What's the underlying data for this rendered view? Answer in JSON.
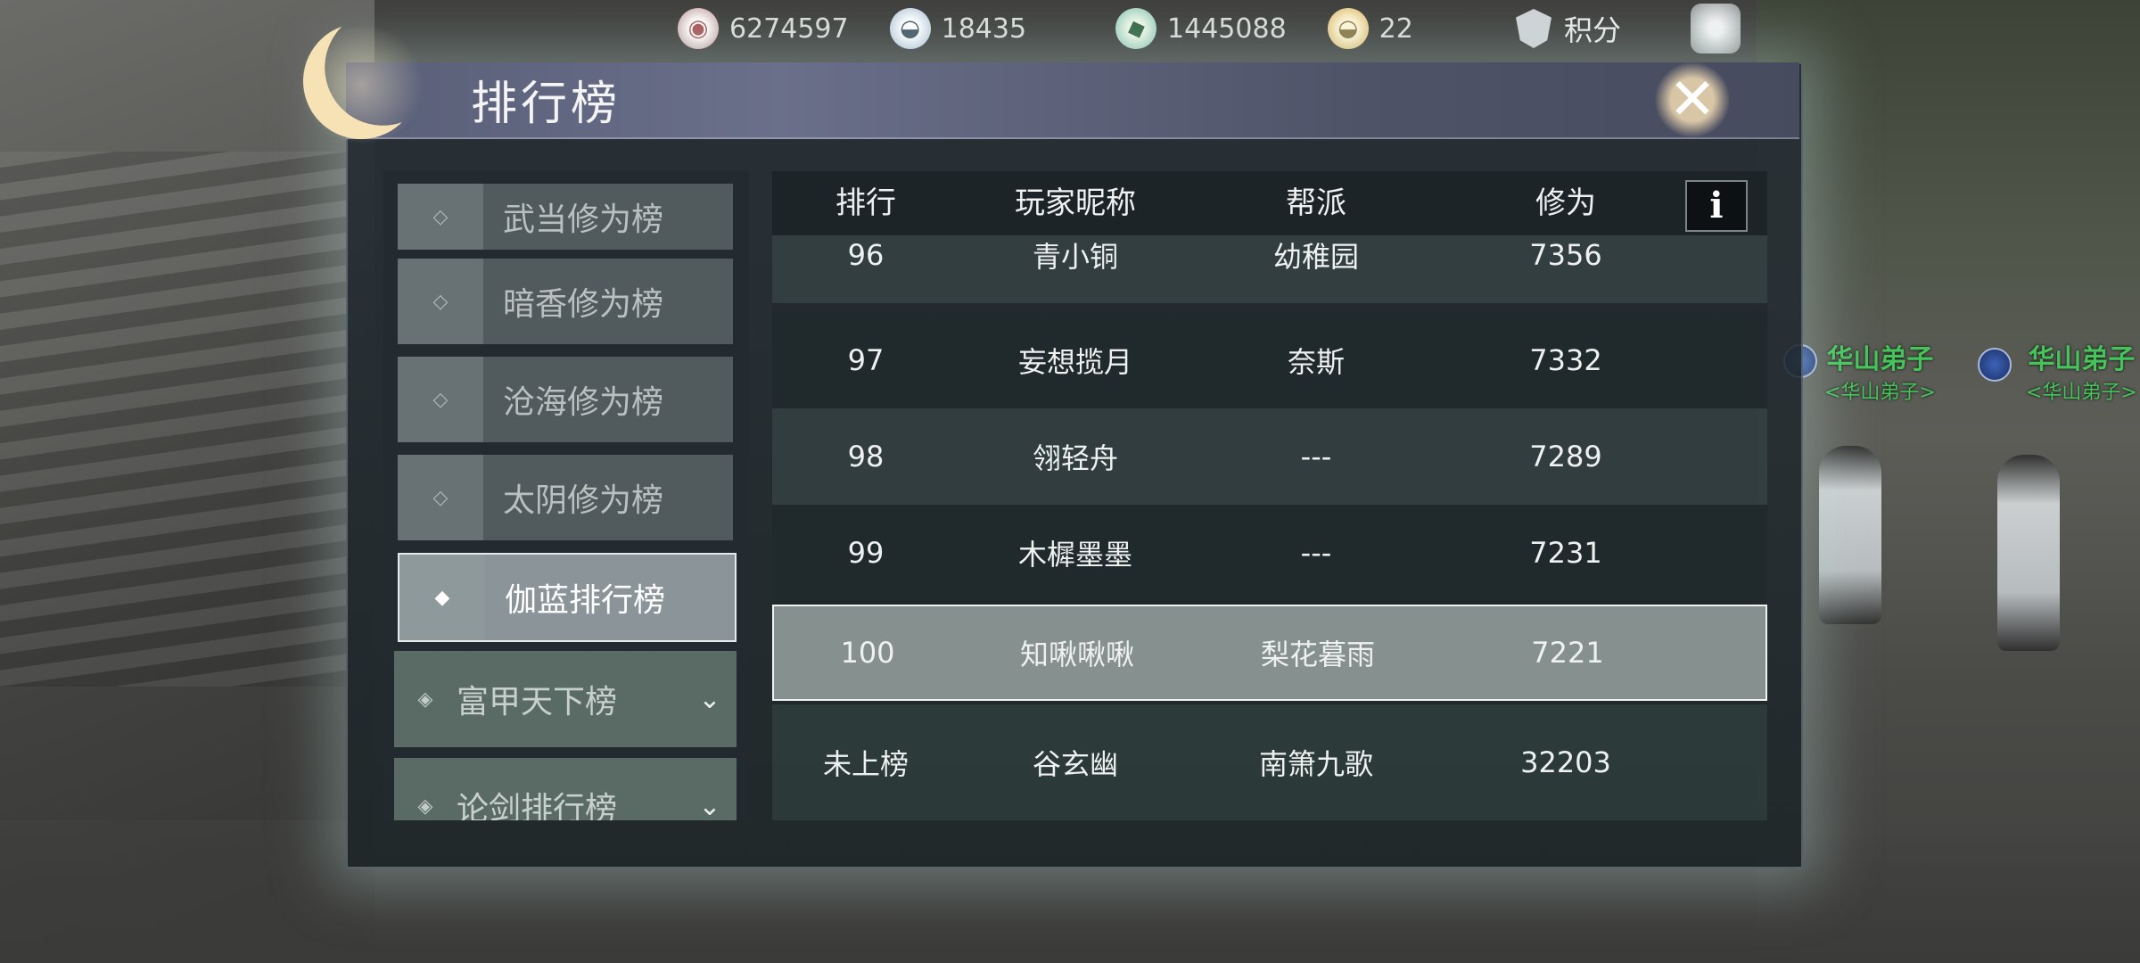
{
  "currencies": [
    {
      "icon": "coin-icon",
      "value": "6274597"
    },
    {
      "icon": "silver-ingot-icon",
      "value": "18435"
    },
    {
      "icon": "jade-icon",
      "value": "1445088"
    },
    {
      "icon": "gold-ingot-icon",
      "value": "22"
    }
  ],
  "points_label": "积分",
  "window_title": "排行榜",
  "npcs": [
    {
      "name": "华山弟子",
      "title": "<华山弟子>"
    },
    {
      "name": "华山弟子",
      "title": "<华山弟子>"
    }
  ],
  "sidebar": {
    "items": [
      {
        "label": "武当修为榜",
        "active": false
      },
      {
        "label": "暗香修为榜",
        "active": false
      },
      {
        "label": "沧海修为榜",
        "active": false
      },
      {
        "label": "太阴修为榜",
        "active": false
      },
      {
        "label": "伽蓝排行榜",
        "active": true
      }
    ],
    "groups": [
      {
        "label": "富甲天下榜"
      },
      {
        "label": "论剑排行榜"
      }
    ]
  },
  "table": {
    "headers": [
      "排行",
      "玩家昵称",
      "帮派",
      "修为"
    ],
    "info_label": "i",
    "rows": [
      {
        "rank": "96",
        "name": "青小铜",
        "guild": "幼稚园",
        "score": "7356"
      },
      {
        "rank": "97",
        "name": "妄想揽月",
        "guild": "奈斯",
        "score": "7332"
      },
      {
        "rank": "98",
        "name": "翎轻舟",
        "guild": "---",
        "score": "7289"
      },
      {
        "rank": "99",
        "name": "木樨墨墨",
        "guild": "---",
        "score": "7231"
      },
      {
        "rank": "100",
        "name": "知啾啾啾",
        "guild": "梨花暮雨",
        "score": "7221"
      }
    ],
    "self": {
      "rank": "未上榜",
      "name": "谷玄幽",
      "guild": "南箫九歌",
      "score": "32203"
    }
  }
}
